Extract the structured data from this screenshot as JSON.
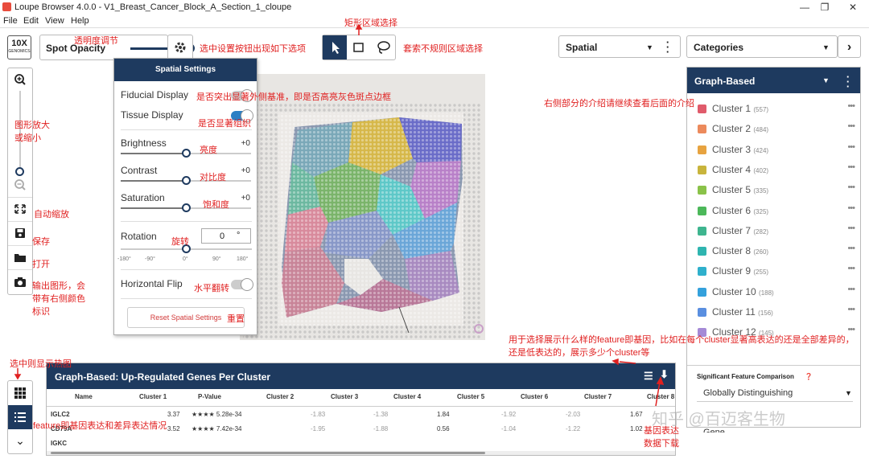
{
  "window": {
    "title": "Loupe Browser 4.0.0 - V1_Breast_Cancer_Block_A_Section_1_cloupe",
    "controls": [
      "—",
      "❐",
      "✕"
    ]
  },
  "menu": [
    "File",
    "Edit",
    "View",
    "Help"
  ],
  "logo": {
    "main": "10X",
    "sub": "GENOMICS"
  },
  "toolbar": {
    "spot_opacity": "Spot Opacity",
    "gear_icon": "gear-icon"
  },
  "spatial_dropdown": "Spatial",
  "categories_dropdown": "Categories",
  "spatial_settings": {
    "title": "Spatial Settings",
    "fiducial": "Fiducial Display",
    "tissue": "Tissue Display",
    "brightness": "Brightness",
    "brightness_val": "+0",
    "contrast": "Contrast",
    "contrast_val": "+0",
    "saturation": "Saturation",
    "saturation_val": "+0",
    "rotation": "Rotation",
    "rotation_val": "0",
    "rotation_unit": "°",
    "rotation_ticks": [
      "-180°",
      "-90°",
      "0°",
      "90°",
      "180°"
    ],
    "flip": "Horizontal Flip",
    "reset": "Reset Spatial Settings"
  },
  "graph_panel": {
    "title": "Graph-Based",
    "clusters": [
      {
        "name": "Cluster 1",
        "count": "(557)",
        "color": "#e05b6b"
      },
      {
        "name": "Cluster 2",
        "count": "(484)",
        "color": "#ec8a5c"
      },
      {
        "name": "Cluster 3",
        "count": "(424)",
        "color": "#e7a340"
      },
      {
        "name": "Cluster 4",
        "count": "(402)",
        "color": "#c8b43c"
      },
      {
        "name": "Cluster 5",
        "count": "(335)",
        "color": "#8ac249"
      },
      {
        "name": "Cluster 6",
        "count": "(325)",
        "color": "#4cb85a"
      },
      {
        "name": "Cluster 7",
        "count": "(282)",
        "color": "#3eb58f"
      },
      {
        "name": "Cluster 8",
        "count": "(260)",
        "color": "#2fb5b0"
      },
      {
        "name": "Cluster 9",
        "count": "(255)",
        "color": "#2fb0cc"
      },
      {
        "name": "Cluster 10",
        "count": "(188)",
        "color": "#34a1dc"
      },
      {
        "name": "Cluster 11",
        "count": "(156)",
        "color": "#5a8fe0"
      },
      {
        "name": "Cluster 12",
        "count": "(145)",
        "color": "#a58ad6"
      }
    ],
    "sig_label": "Significant Feature Comparison",
    "sig_value": "Globally Distinguishing",
    "gene": "Gene"
  },
  "table": {
    "title": "Graph-Based: Up-Regulated Genes Per Cluster",
    "headers": [
      "Name",
      "Cluster 1",
      "P-Value",
      "Cluster 2",
      "Cluster 3",
      "Cluster 4",
      "Cluster 5",
      "Cluster 6",
      "Cluster 7",
      "Cluster 8"
    ],
    "rows": [
      {
        "name": "IGLC2",
        "c1": "3.37",
        "p": "★★★★ 5.28e-34",
        "c2": "-1.83",
        "c3": "-1.38",
        "c4": "1.84",
        "c5": "-1.92",
        "c6": "-2.03",
        "c7": "1.67"
      },
      {
        "name": "CD79A",
        "c1": "3.52",
        "p": "★★★★ 7.42e-34",
        "c2": "-1.95",
        "c3": "-1.88",
        "c4": "0.56",
        "c5": "-1.04",
        "c6": "-1.22",
        "c7": "1.02"
      },
      {
        "name": "IGKC",
        "c1": "",
        "p": "",
        "c2": "",
        "c3": "",
        "c4": "",
        "c5": "",
        "c6": "",
        "c7": ""
      }
    ]
  },
  "annotations": {
    "opacity": "透明度调节",
    "gear": "选中设置按钮出现如下选项",
    "rect": "矩形区域选择",
    "lasso": "套索不规则区域选择",
    "fiducial": "是否突出显著外侧基准，即是否高亮灰色斑点边框",
    "tissue": "是否显著组织",
    "brightness": "亮度",
    "contrast": "对比度",
    "saturation": "饱和度",
    "rotation": "旋转",
    "flip": "水平翻转",
    "reset": "重置",
    "zoom": "图形放大或缩小",
    "auto": "自动缩放",
    "save": "保存",
    "open": "打开",
    "export": "输出图形，会带有右侧颜色标识",
    "right": "右侧部分的介绍请继续查看后面的介绍",
    "heatmap": "选中则显示热图",
    "feature": "feature即基因表达和差异表达情况",
    "feature_select": "用于选择展示什么样的feature即基因，比如在每个cluster显著高表达的还是全部差异的，还是低表达的，展示多少个cluster等",
    "download": "基因表达数据下载",
    "watermark": "知乎 @百迈客生物"
  }
}
